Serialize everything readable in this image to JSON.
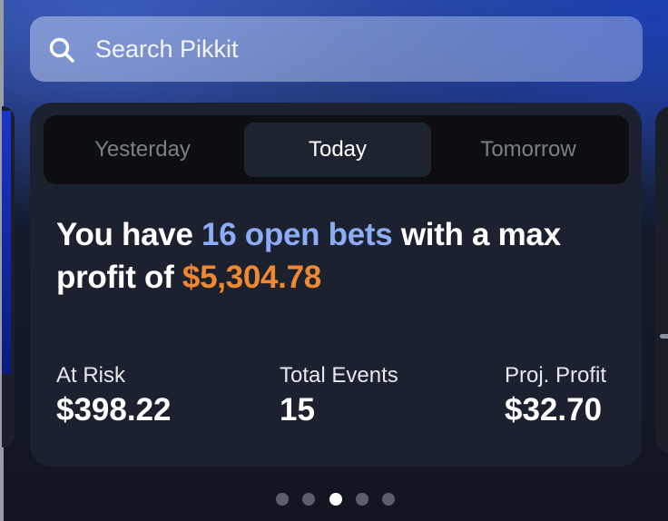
{
  "search": {
    "placeholder": "Search Pikkit",
    "icon": "search-icon"
  },
  "tabs": [
    {
      "label": "Yesterday",
      "active": false
    },
    {
      "label": "Today",
      "active": true
    },
    {
      "label": "Tomorrow",
      "active": false
    }
  ],
  "summary": {
    "prefix": "You have ",
    "open_bets": "16 open bets",
    "middle": " with a max profit of ",
    "max_profit": "$5,304.78"
  },
  "stats": [
    {
      "label": "At Risk",
      "value": "$398.22"
    },
    {
      "label": "Total Events",
      "value": "15"
    },
    {
      "label": "Proj. Profit",
      "value": "$32.70"
    }
  ],
  "pager": {
    "count": 5,
    "active_index": 2
  },
  "colors": {
    "accent_blue": "#8cadf5",
    "accent_orange": "#f0882f",
    "card_bg": "#1c2130"
  }
}
